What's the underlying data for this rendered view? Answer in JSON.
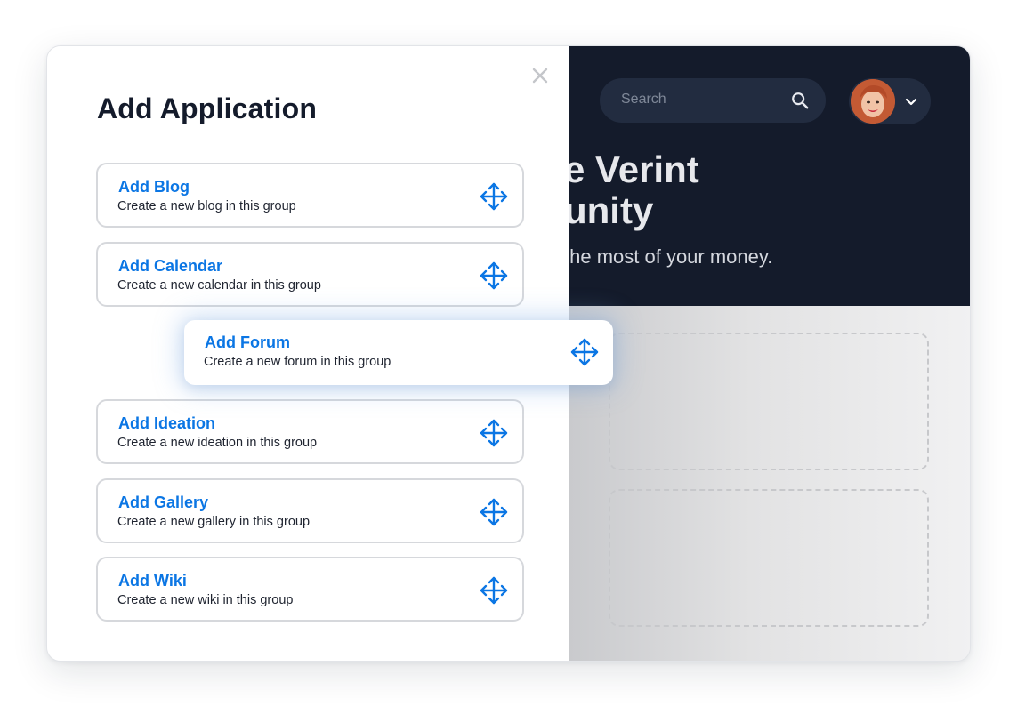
{
  "panel": {
    "title": "Add Application",
    "close_symbol": "×",
    "items": [
      {
        "title": "Add Blog",
        "description": "Create a new blog in this group",
        "icon": "move-icon"
      },
      {
        "title": "Add Calendar",
        "description": "Create a new calendar in this group",
        "icon": "move-icon"
      },
      {
        "title": "Add Forum",
        "description": "Create a new forum in this group",
        "icon": "move-icon",
        "state": "dragging"
      },
      {
        "title": "Add Ideation",
        "description": "Create a new ideation in this group",
        "icon": "move-icon"
      },
      {
        "title": "Add Gallery",
        "description": "Create a new gallery in this group",
        "icon": "move-icon"
      },
      {
        "title": "Add Wiki",
        "description": "Create a new wiki in this group",
        "icon": "move-icon"
      }
    ]
  },
  "header": {
    "search_placeholder": "Search",
    "search_icon": "search-icon",
    "user_menu_icon": "chevron-down-icon"
  },
  "hero": {
    "title_line1": "e Verint",
    "title_line2": "unity",
    "subtitle": "the most of your money."
  },
  "colors": {
    "accent": "#0b76e4",
    "hero_background": "#141b2b",
    "panel_background": "#ffffff"
  }
}
